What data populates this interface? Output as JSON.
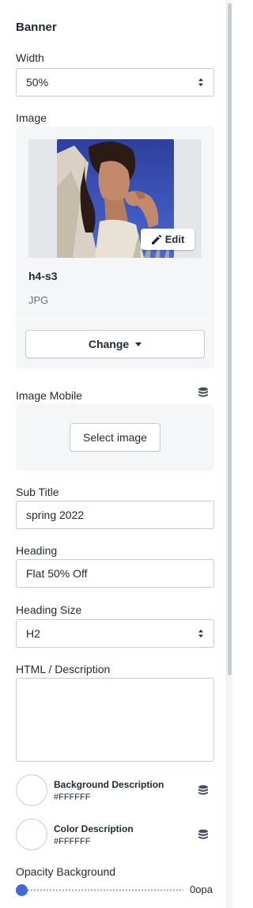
{
  "section": {
    "title": "Banner"
  },
  "width_setting": {
    "label": "Width",
    "value": "50%"
  },
  "image_setting": {
    "label": "Image",
    "edit_label": "Edit",
    "file_name": "h4-s3",
    "file_type": "JPG",
    "change_label": "Change"
  },
  "image_mobile_setting": {
    "label": "Image Mobile",
    "button_label": "Select image",
    "icon": "database-icon"
  },
  "sub_title_setting": {
    "label": "Sub Title",
    "value": "spring 2022"
  },
  "heading_setting": {
    "label": "Heading",
    "value": "Flat 50% Off"
  },
  "heading_size_setting": {
    "label": "Heading Size",
    "value": "H2"
  },
  "description_setting": {
    "label": "HTML / Description",
    "value": ""
  },
  "background_description": {
    "title": "Background Description",
    "hex": "#FFFFFF",
    "color": "#ffffff",
    "icon": "database-icon"
  },
  "color_description": {
    "title": "Color Description",
    "hex": "#FFFFFF",
    "color": "#ffffff",
    "icon": "database-icon"
  },
  "opacity_background": {
    "label": "Opacity Background",
    "value_text": "0opa",
    "value": 0
  },
  "colors": {
    "accent": "#3f6ad8",
    "border": "#c4cdd5",
    "card_bg": "#f4f6f8",
    "text": "#212b36",
    "muted": "#637381"
  }
}
